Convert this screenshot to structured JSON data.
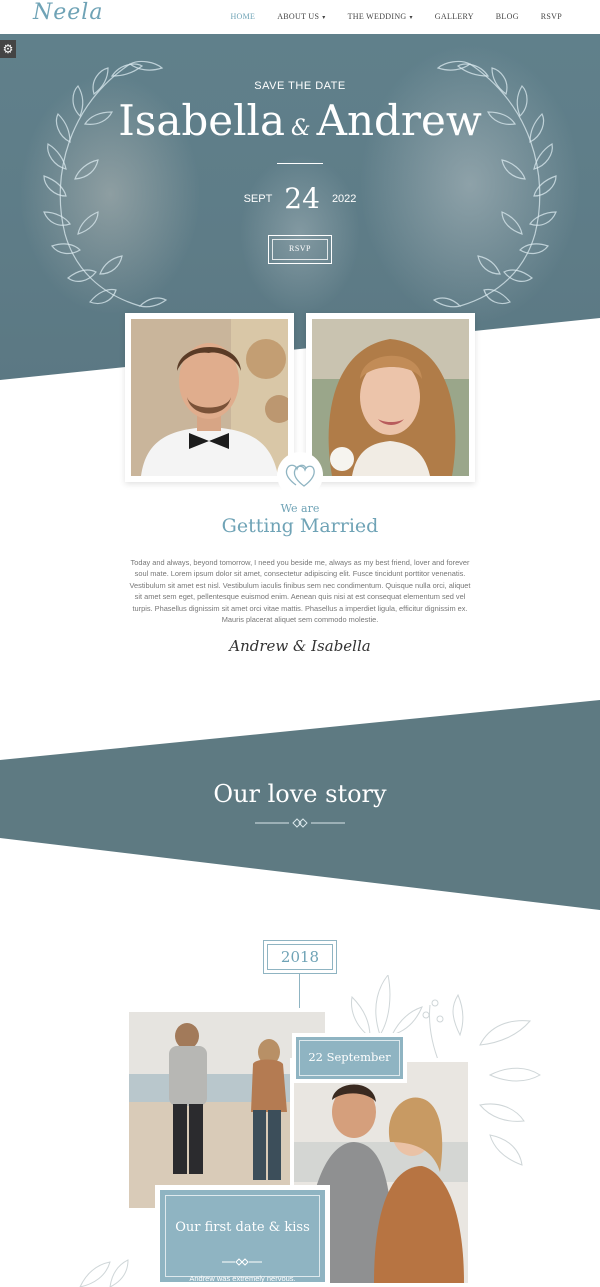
{
  "nav": {
    "logo": "Neela",
    "items": [
      {
        "label": "HOME",
        "dropdown": false,
        "active": true
      },
      {
        "label": "ABOUT US",
        "dropdown": true,
        "active": false
      },
      {
        "label": "THE WEDDING",
        "dropdown": true,
        "active": false
      },
      {
        "label": "GALLERY",
        "dropdown": false,
        "active": false
      },
      {
        "label": "BLOG",
        "dropdown": false,
        "active": false
      },
      {
        "label": "RSVP",
        "dropdown": false,
        "active": false
      }
    ]
  },
  "hero": {
    "kicker": "SAVE THE DATE",
    "bride": "Isabella",
    "ampersand": "&",
    "groom": "Andrew",
    "month": "SEPT",
    "day": "24",
    "year": "2022",
    "button": "RSVP"
  },
  "intro": {
    "small_title": "We are",
    "title": "Getting Married",
    "paragraph": "Today and always, beyond tomorrow, I need you beside me, always as my best friend, lover and forever soul mate. Lorem ipsum dolor sit amet, consectetur adipiscing elit. Fusce tincidunt porttitor venenatis. Vestibulum sit amet est nisl. Vestibulum iaculis finibus sem nec condimentum. Quisque nulla orci, aliquet sit amet sem eget, pellentesque euismod enim. Aenean quis nisi at est consequat elementum sed vel turpis. Phasellus dignissim sit amet orci vitae mattis. Phasellus a imperdiet ligula, efficitur dignissim ex. Mauris placerat aliquet sem commodo molestie.",
    "signature": "Andrew & Isabella"
  },
  "love_story": {
    "title": "Our love story",
    "year": "2018",
    "date_tag": "22 September",
    "card_title": "Our first date & kiss",
    "card_text": "Andrew was extremely nervous."
  },
  "colors": {
    "accent": "#6fa3b6",
    "band": "#5e7a82",
    "card": "#8fb4c2"
  },
  "icons": {
    "settings": "gear-icon",
    "heart": "double-heart-icon",
    "ornament": "diamond-ornament-icon"
  }
}
